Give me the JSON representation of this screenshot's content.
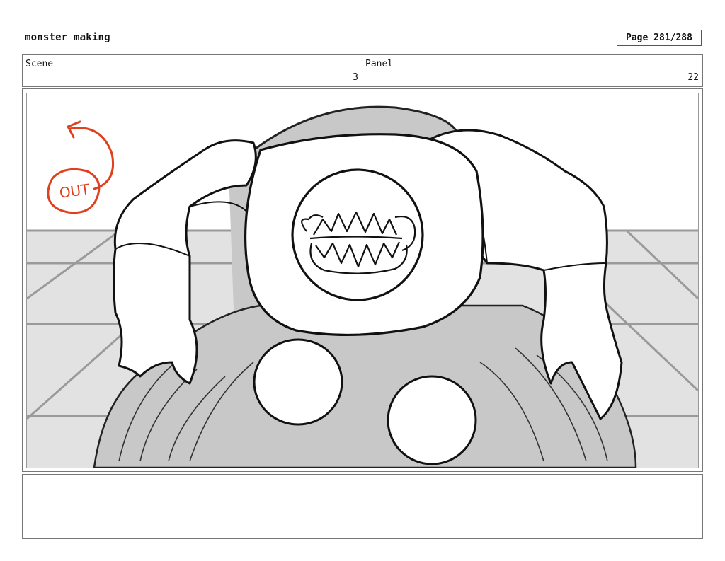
{
  "header": {
    "project_title": "monster making",
    "page_label": "Page 281/288"
  },
  "info_row": {
    "scene_label": "Scene",
    "scene_number": "3",
    "panel_label": "Panel",
    "panel_number": "22"
  },
  "drawing": {
    "annotation_text": "OUT",
    "annotation_color": "#e0401e",
    "fill_gray": "#c8c8c8",
    "floor_gray": "#e2e2e2"
  },
  "notes": {
    "text": ""
  }
}
